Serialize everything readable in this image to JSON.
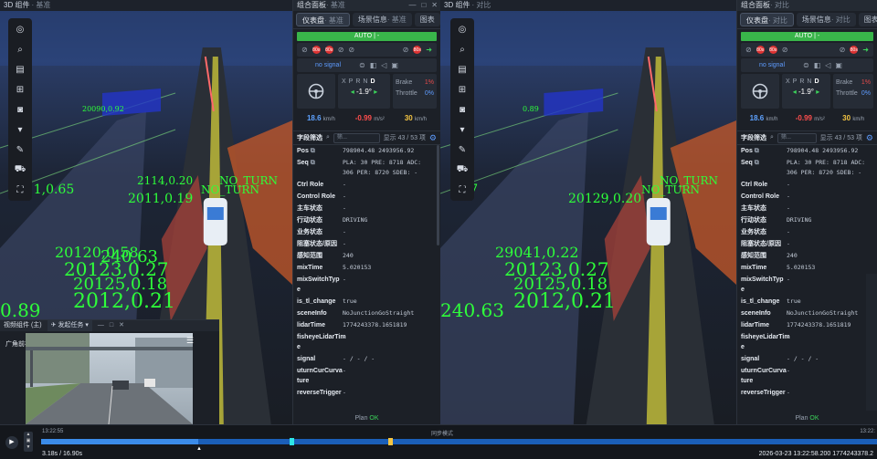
{
  "left_view": {
    "title": "3D 组件",
    "subtitle": "· 基准",
    "overlay_texts": [
      "2012,0.21",
      "20123,0.27",
      "20125,0.18",
      "20120,0.58",
      "2011,0.19",
      "NO_TURN",
      "NO_TURN",
      "20090,0.92",
      "2011,0.65",
      "0.89",
      "2114,0.20",
      "240.63"
    ]
  },
  "right_view": {
    "title": "3D 组件",
    "subtitle": "· 对比",
    "overlay_texts": [
      "2012,0.21",
      "20123,0.27",
      "20125,0.18",
      "29041,0.22",
      "20129,0.20",
      "NO_TURN",
      "NO_TURN",
      "0.89",
      "1.97",
      "240.63"
    ]
  },
  "toolbar_icons": [
    "target-icon",
    "search-icon",
    "document-icon",
    "grid-icon",
    "camera-icon",
    "cup-icon",
    "ruler-icon",
    "car-icon",
    "frame-icon"
  ],
  "left_panel": {
    "title": "组合面板",
    "subtitle": "· 基准",
    "tabs": [
      {
        "label": "仪表盘",
        "sub": "· 基准",
        "active": true
      },
      {
        "label": "场景信息",
        "sub": "· 基准",
        "active": false
      },
      {
        "label": "图表",
        "sub": "",
        "active": false
      }
    ],
    "add_label": "+",
    "auto": "AUTO | -",
    "signal_counts": [
      "80s",
      "80s"
    ],
    "no_signal": "no signal",
    "gears": [
      "X",
      "P",
      "R",
      "N",
      "D"
    ],
    "active_gear": "D",
    "steer_angle": "-1.9°",
    "brake_label": "Brake",
    "brake_pct": "1%",
    "throttle_label": "Throttle",
    "throttle_pct": "0%",
    "speed": "18.6",
    "speed_unit": "km/h",
    "accel": "-0.99",
    "accel_unit": "m/s²",
    "limit": "30",
    "limit_unit": "km/h",
    "filter_title": "字段筛选",
    "search_placeholder": "筛...",
    "count": "显示 43 / 53 项",
    "fields": [
      {
        "k": "Pos",
        "v": "798904.48 2493956.92"
      },
      {
        "k": "Seq",
        "v": "PLA: 30 PRE: 8718 ADC:\n306 PER: 8720 SDEB: -"
      },
      {
        "k": "Ctrl Role",
        "v": "-"
      },
      {
        "k": "Control Role",
        "v": "-"
      },
      {
        "k": "主车状态",
        "v": "-"
      },
      {
        "k": "行动状态",
        "v": "DRIVING"
      },
      {
        "k": "业务状态",
        "v": "-"
      },
      {
        "k": "阻塞状态/原因",
        "v": "-"
      },
      {
        "k": "感知范围",
        "v": "240"
      },
      {
        "k": "mixTime",
        "v": "5.020153"
      },
      {
        "k": "mixSwitchTyp\ne",
        "v": "-"
      },
      {
        "k": "is_tl_change",
        "v": "true"
      },
      {
        "k": "sceneInfo",
        "v": "NoJunctionGoStraight"
      },
      {
        "k": "lidarTime",
        "v": "1774243378.1651819"
      },
      {
        "k": "fisheyeLidarTim\ne",
        "v": "-"
      },
      {
        "k": "signal",
        "v": "- / - / -"
      },
      {
        "k": "uturnCurCurva\nture",
        "v": "-"
      },
      {
        "k": "reverseTrigger",
        "v": "-"
      }
    ],
    "plan": "Plan",
    "plan_status": "OK"
  },
  "right_panel": {
    "title": "组合面板",
    "subtitle": "· 对比",
    "tabs": [
      {
        "label": "仪表盘",
        "sub": "· 对比",
        "active": true
      },
      {
        "label": "场景信息",
        "sub": "· 对比",
        "active": false
      },
      {
        "label": "图表",
        "sub": "",
        "active": false
      }
    ]
  },
  "video": {
    "title": "视频组件 (主)",
    "task": "发起任务",
    "camera": "广角前视"
  },
  "timeline": {
    "start_time": "13:22:55",
    "mode": "同步模式",
    "end_time": "13:22:",
    "position": "3.18s / 16.90s",
    "progress": 0.188,
    "footer_right": "2026-03-23 13:22:58.200  1774243378.2"
  }
}
